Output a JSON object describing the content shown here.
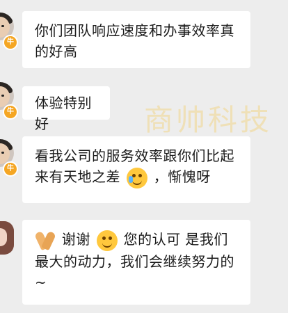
{
  "watermark": "商帅科技",
  "badge": "牛",
  "messages": [
    {
      "text": "你们团队响应速度和办事效率真的好高"
    },
    {
      "text": "体验特别好"
    },
    {
      "text_before": "看我公司的服务效率跟你们比起来有天地之差",
      "emoji": "crying-laugh-emoji",
      "text_after": "，惭愧呀"
    },
    {
      "text_prefix_emoji": "folded-hands-emoji",
      "thanks": "谢谢",
      "emoji": "smile-emoji",
      "text": "您的认可 是我们最大的动力，我们会继续努力的~"
    }
  ],
  "colors": {
    "background": "#ededed",
    "bubble": "#ffffff",
    "badge": "#f5a623",
    "watermark": "#efe0b7"
  }
}
